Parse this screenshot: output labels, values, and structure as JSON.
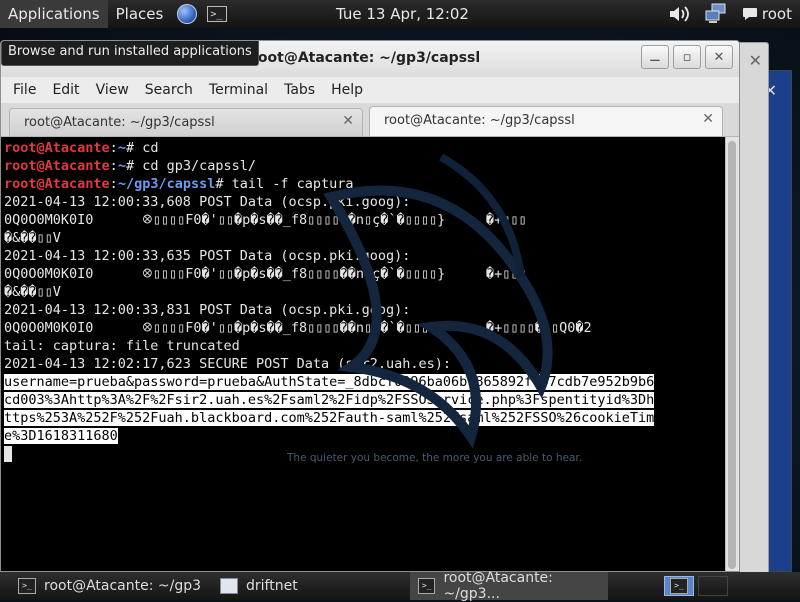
{
  "top_panel": {
    "applications": "Applications",
    "places": "Places",
    "clock": "Tue 13 Apr, 12:02",
    "user": "root"
  },
  "tooltip": "Browse and run installed applications",
  "window": {
    "title": "root@Atacante: ~/gp3/capssl",
    "menu": [
      "File",
      "Edit",
      "View",
      "Search",
      "Terminal",
      "Tabs",
      "Help"
    ],
    "tabs": [
      {
        "label": "root@Atacante: ~/gp3/capssl"
      },
      {
        "label": "root@Atacante: ~/gp3/capssl"
      }
    ]
  },
  "terminal": {
    "prompt_user": "root@Atacante",
    "commands": [
      {
        "path": "~",
        "cmd": "# cd"
      },
      {
        "path": "~",
        "cmd": "# cd gp3/capssl/"
      },
      {
        "path": "~/gp3/capssl",
        "cmd": "# tail -f captura"
      }
    ],
    "output": [
      "2021-04-13 12:00:33,608 POST Data (ocsp.pki.goog):",
      "0Q0O0M0K0I0      ꕕ▯▯▯▯F0�'▯▯�p�s��_f8▯▯▯▯��n▯ç�`�▯▯▯▯}     �+▯▯▯",
      "�&��▯▯V",
      "2021-04-13 12:00:33,635 POST Data (ocsp.pki.goog):",
      "0Q0O0M0K0I0      ꕕ▯▯▯▯F0�'▯▯�p�s��_f8▯▯▯▯��n▯ç�`�▯▯▯▯}     �+▯▯▯",
      "�&��▯▯V",
      "2021-04-13 12:00:33,831 POST Data (ocsp.pki.goog):",
      "0Q0O0M0K0I0      ꕕ▯▯▯▯F0�'▯▯�p�s��_f8▯▯▯▯��n▯ç�`�▯▯▯▯}     �+▯▯▯▯�▯▯Q0�2",
      "tail: captura: file truncated",
      "2021-04-13 12:02:17,623 SECURE POST Data (sir2.uah.es):"
    ],
    "highlight": [
      "username=prueba&password=prueba&AuthState=_8dbcf0396ba06b1865892f747cdb7e952b9b6",
      "cd003%3Ahttp%3A%2F%2Fsir2.uah.es%2Fsaml2%2Fidp%2FSSOService.php%3Fspentityid%3Dh",
      "ttps%253A%252F%252Fuah.blackboard.com%252Fauth-saml%252Fsaml%252FSSO%26cookieTim",
      "e%3D1618311680"
    ],
    "background_tagline": "The quieter you become, the more you are able to hear."
  },
  "taskbar": {
    "items": [
      {
        "label": "root@Atacante: ~/gp3",
        "icon": "terminal-icon"
      },
      {
        "label": "driftnet",
        "icon": "window-icon"
      },
      {
        "label": "root@Atacante: ~/gp3...",
        "icon": "terminal-icon"
      }
    ]
  }
}
